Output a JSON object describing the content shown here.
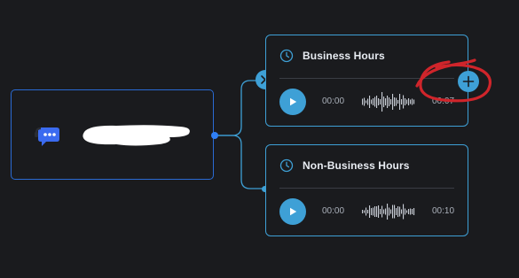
{
  "colors": {
    "background": "#1a1b1e",
    "source_border": "#2a6bd4",
    "accent": "#3ea0d6",
    "text": "#e8ecf2",
    "muted_text": "#aab0ba",
    "annotation": "#d0252b"
  },
  "source_node": {
    "avatar_icon": "chat-bot-icon",
    "label_redacted": true
  },
  "branches": [
    {
      "icon": "clock-icon",
      "title": "Business Hours",
      "time_start": "00:00",
      "time_end": "00:07",
      "play_icon": "play-icon"
    },
    {
      "icon": "clock-icon",
      "title": "Non-Business Hours",
      "time_start": "00:00",
      "time_end": "00:10",
      "play_icon": "play-icon"
    }
  ],
  "controls": {
    "remove_icon": "close-icon",
    "add_icon": "plus-icon"
  }
}
